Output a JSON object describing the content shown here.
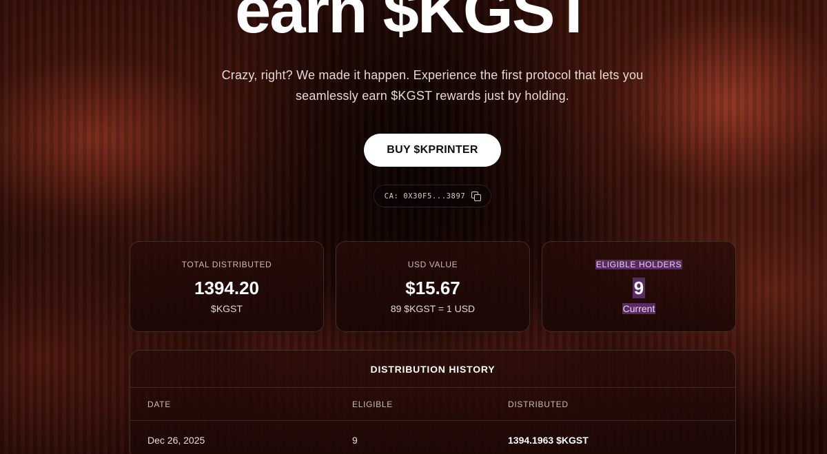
{
  "hero": {
    "title": "earn $KGST",
    "subtitle_line1": "Crazy, right? We made it happen. Experience the first protocol that lets you",
    "subtitle_line2": "seamlessly earn $KGST rewards just by holding.",
    "buy_label": "BUY $KPRINTER",
    "ca_label": "CA: 0X30F5...3897"
  },
  "stats": [
    {
      "label": "TOTAL DISTRIBUTED",
      "value": "1394.20",
      "unit": "$KGST"
    },
    {
      "label": "USD VALUE",
      "value": "$15.67",
      "unit": "89 $KGST = 1 USD"
    },
    {
      "label": "ELIGIBLE HOLDERS",
      "value": "9",
      "unit": "Current"
    }
  ],
  "history": {
    "title": "DISTRIBUTION HISTORY",
    "headers": [
      "DATE",
      "ELIGIBLE",
      "DISTRIBUTED"
    ],
    "rows": [
      [
        "Dec 26, 2025",
        "9",
        "1394.1963 $KGST"
      ]
    ]
  },
  "colors": {
    "highlight": "#5a2a63",
    "button_bg": "#ffffff",
    "accent_glow": "#8a3220"
  },
  "icons": {
    "copy": "copy-icon"
  }
}
